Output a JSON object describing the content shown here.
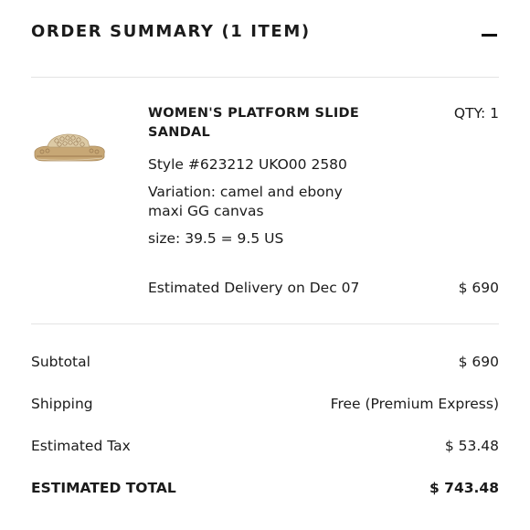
{
  "header": {
    "title": "ORDER SUMMARY (1 ITEM)"
  },
  "item": {
    "name": "WOMEN'S PLATFORM SLIDE SANDAL",
    "qty": "QTY: 1",
    "style": "Style #623212 UKO00 2580",
    "variation": "Variation: camel and ebony maxi GG canvas",
    "size": "size: 39.5 = 9.5 US",
    "delivery": "Estimated Delivery on Dec 07",
    "price": "$ 690",
    "image_icon": "sandal-thumbnail",
    "colors": {
      "canvas": "#d9c8a6",
      "sole": "#c9a97a",
      "accent": "#7a5a3a"
    }
  },
  "summary": {
    "subtotal_label": "Subtotal",
    "subtotal_value": "$ 690",
    "shipping_label": "Shipping",
    "shipping_value": "Free (Premium Express)",
    "tax_label": "Estimated Tax",
    "tax_value": "$ 53.48",
    "total_label": "ESTIMATED TOTAL",
    "total_value": "$ 743.48"
  }
}
